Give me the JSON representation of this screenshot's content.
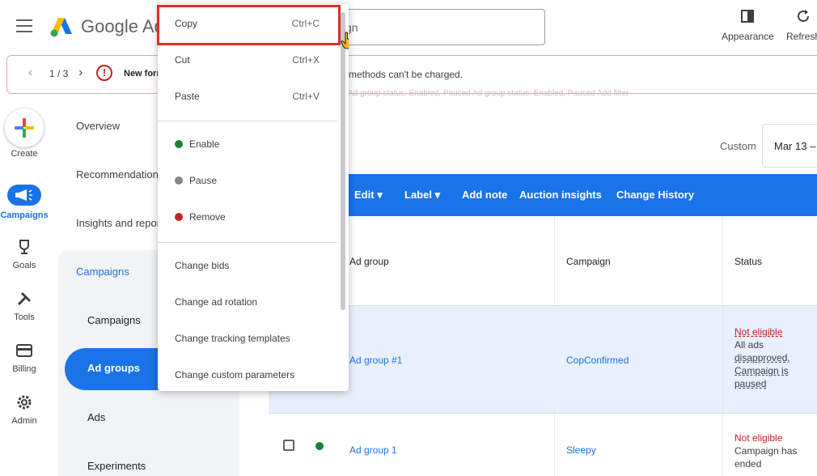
{
  "header": {
    "brand": "Google Ads",
    "search_placeholder": "gn",
    "appearance_label": "Appearance",
    "refresh_label": "Refresh"
  },
  "banner": {
    "counter": "1 / 3",
    "message_bold": "New form",
    "message_rest": "methods can't be charged."
  },
  "rail": {
    "create": "Create",
    "campaigns": "Campaigns",
    "goals": "Goals",
    "tools": "Tools",
    "billing": "Billing",
    "admin": "Admin"
  },
  "nav": {
    "overview": "Overview",
    "recommendations": "Recommendations",
    "insights": "Insights and reports",
    "campaigns_group": "Campaigns",
    "campaigns": "Campaigns",
    "ad_groups": "Ad groups",
    "ads": "Ads",
    "experiments": "Experiments"
  },
  "filters": "Ad group status: Enabled, Paused     Ad group status: Enabled, Paused     Add filter",
  "date": {
    "label": "Custom",
    "value": "Mar 13 –"
  },
  "toolbar": {
    "edit": "Edit",
    "label": "Label",
    "add_note": "Add note",
    "auction_insights": "Auction insights",
    "change_history": "Change History"
  },
  "table": {
    "headers": [
      "Ad group",
      "Campaign",
      "Status"
    ],
    "rows": [
      {
        "ad_group": "Ad group #1",
        "campaign": "CopConfirmed",
        "status_main": "Not eligible",
        "status_detail_1": "All ads",
        "status_detail_2": "disapproved,",
        "status_detail_3": "Campaign is",
        "status_detail_4": "paused"
      },
      {
        "ad_group": "Ad group 1",
        "campaign": "Sleepy",
        "status_main": "Not eligible",
        "status_detail_1": "Campaign has",
        "status_detail_2": "ended"
      }
    ]
  },
  "menu": {
    "copy": "Copy",
    "copy_shortcut": "Ctrl+C",
    "cut": "Cut",
    "cut_shortcut": "Ctrl+X",
    "paste": "Paste",
    "paste_shortcut": "Ctrl+V",
    "enable": "Enable",
    "pause": "Pause",
    "remove": "Remove",
    "change_bids": "Change bids",
    "change_ad_rotation": "Change ad rotation",
    "change_tracking_templates": "Change tracking templates",
    "change_custom_parameters": "Change custom parameters"
  },
  "colors": {
    "accent": "#1a73e8",
    "enabled": "#188038",
    "paused": "#5f6368",
    "removed": "#c5221f",
    "highlight": "#d93025"
  }
}
